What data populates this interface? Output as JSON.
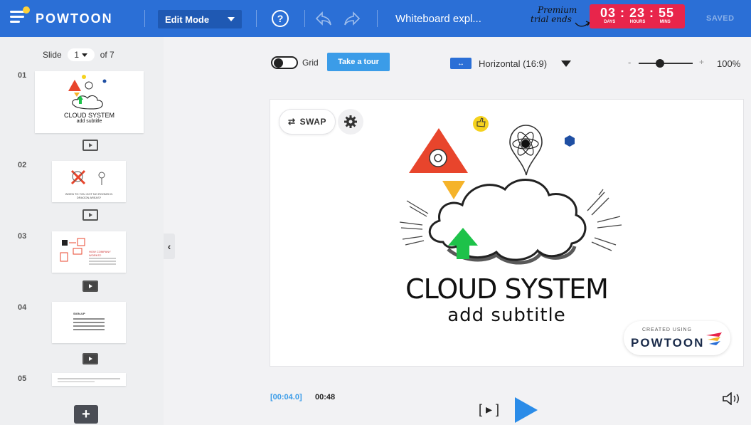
{
  "header": {
    "logo": "POWTOON",
    "mode": "Edit Mode",
    "help": "?",
    "doc_title": "Whiteboard expl...",
    "trial_line1": "Premium",
    "trial_line2": "trial ends",
    "countdown": {
      "days": "03",
      "hours": "23",
      "mins": "55",
      "days_label": "DAYS",
      "hours_label": "HOURS",
      "mins_label": "MINS"
    },
    "saved": "SAVED",
    "colors": {
      "bar": "#2b6fd6",
      "countdown": "#e8254b"
    }
  },
  "sidebar": {
    "slide_label": "Slide",
    "current_slide": "1",
    "of_label": "of 7",
    "slides": [
      {
        "num": "01",
        "title": "CLOUD SYSTEM",
        "subtitle": "add subtitle"
      },
      {
        "num": "02",
        "caption": "WHEN TO YOU GOT NO ROOMS IN DRAGON AREAS?"
      },
      {
        "num": "03",
        "caption": "HOW COMPANY WORKS?"
      },
      {
        "num": "04",
        "caption": "SIGN-UP"
      },
      {
        "num": "05"
      }
    ],
    "add_label": "+"
  },
  "toolbar": {
    "grid_label": "Grid",
    "tour_label": "Take a tour",
    "ratio_label": "Horizontal (16:9)",
    "zoom_minus": "-",
    "zoom_plus": "+",
    "zoom_value": "100%",
    "zoom_level": 0.4
  },
  "canvas": {
    "swap_label": "SWAP",
    "title": "CLOUD SYSTEM",
    "subtitle": "add subtitle",
    "watermark_small": "CREATED USING",
    "watermark_brand": "POWTOON"
  },
  "timeline": {
    "current": "[00:04.0]",
    "total": "00:48"
  }
}
